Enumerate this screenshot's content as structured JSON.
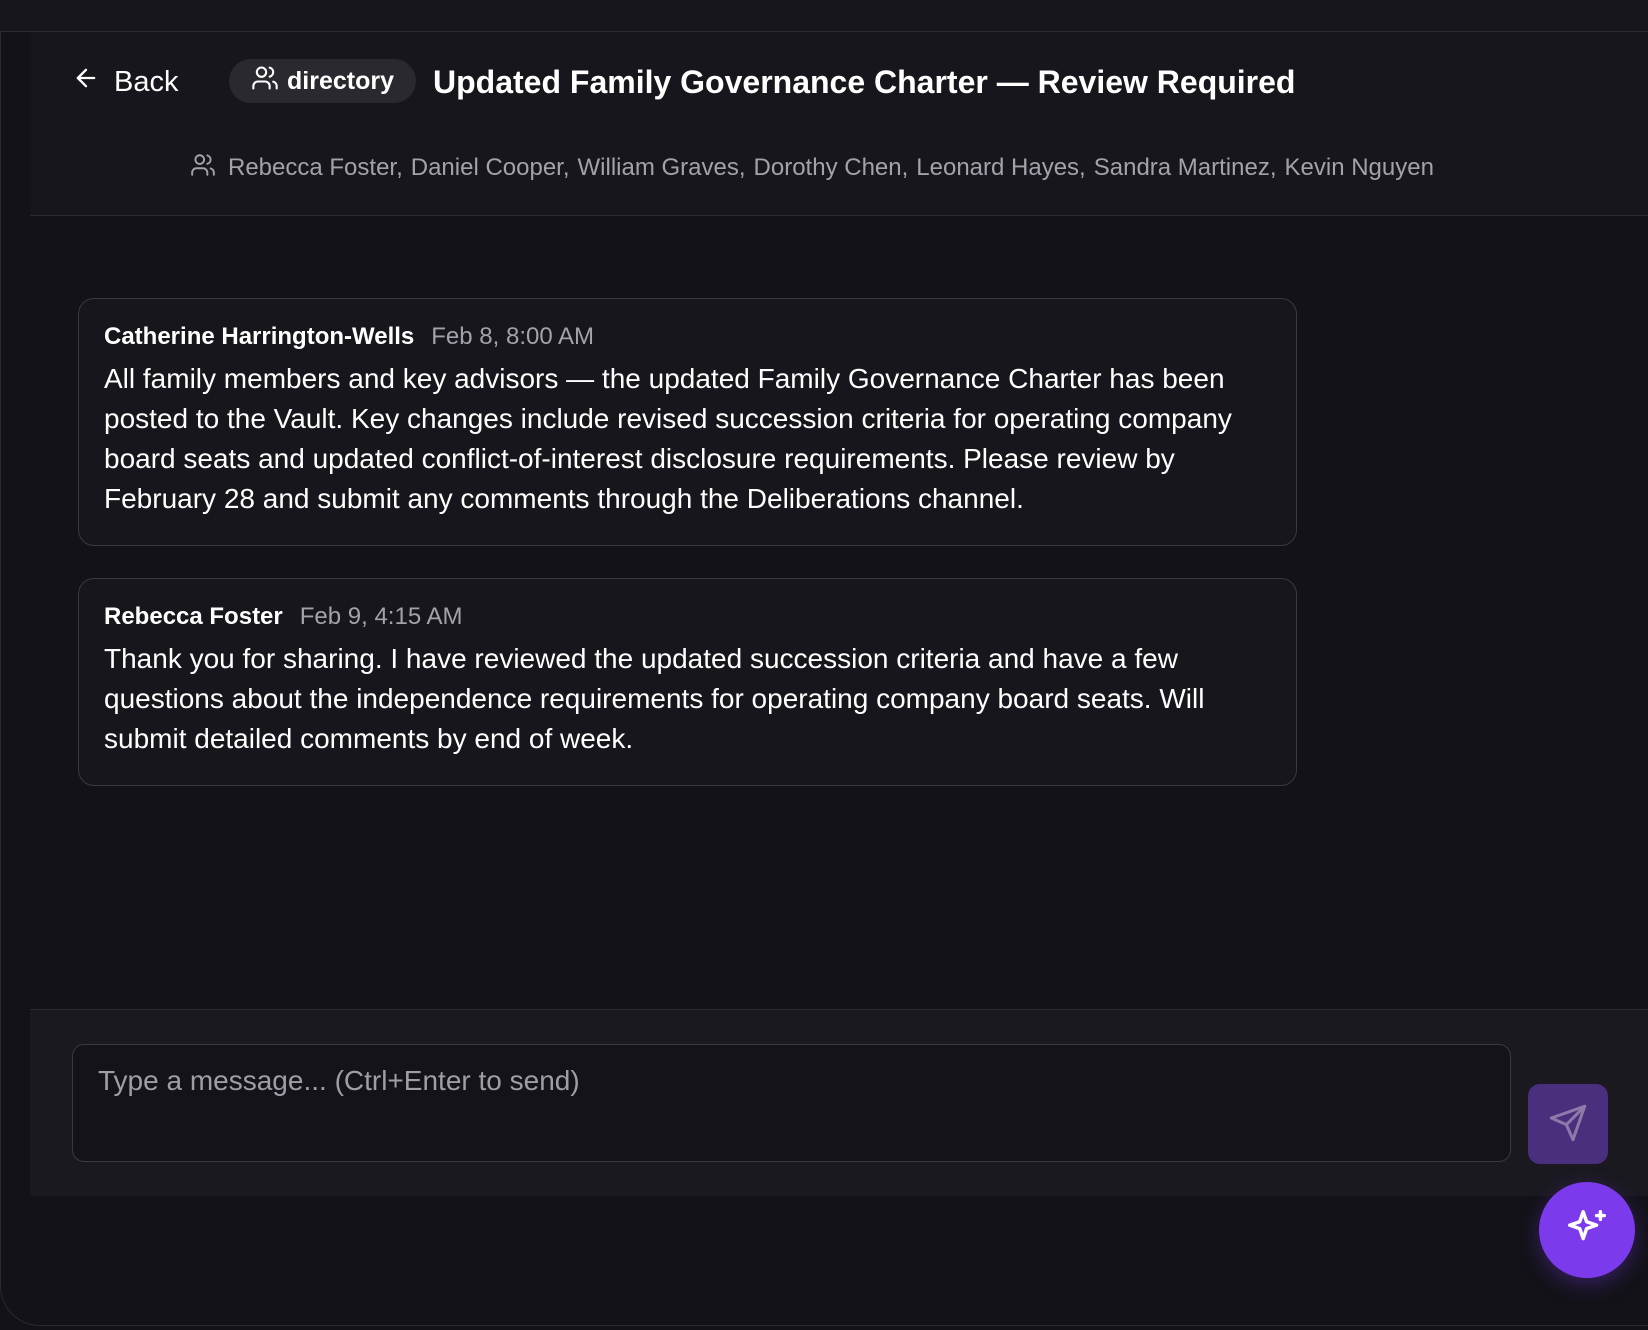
{
  "header": {
    "back_label": "Back",
    "channel_chip": "directory",
    "title": "Updated Family Governance Charter — Review Required",
    "members": [
      "Rebecca Foster,",
      "Daniel Cooper,",
      "William Graves,",
      "Dorothy Chen,",
      "Leonard Hayes,",
      "Sandra Martinez,",
      "Kevin Nguyen"
    ]
  },
  "messages": [
    {
      "author": "Catherine Harrington-Wells",
      "time": "Feb 8, 8:00 AM",
      "body": "All family members and key advisors — the updated Family Governance Charter has been posted to the Vault. Key changes include revised succession criteria for operating company board seats and updated conflict-of-interest disclosure requirements. Please review by February 28 and submit any comments through the Deliberations channel."
    },
    {
      "author": "Rebecca Foster",
      "time": "Feb 9, 4:15 AM",
      "body": "Thank you for sharing. I have reviewed the updated succession criteria and have a few questions about the independence requirements for operating company board seats. Will submit detailed comments by end of week."
    }
  ],
  "composer": {
    "placeholder": "Type a message... (Ctrl+Enter to send)",
    "value": ""
  },
  "icons": {
    "back": "arrow-left-icon",
    "chip": "users-icon",
    "members": "users-icon",
    "send": "send-icon",
    "fab": "sparkles-icon"
  },
  "colors": {
    "accent": "#7c3aed",
    "send_button": "#4a2f7e",
    "background": "#131218"
  }
}
